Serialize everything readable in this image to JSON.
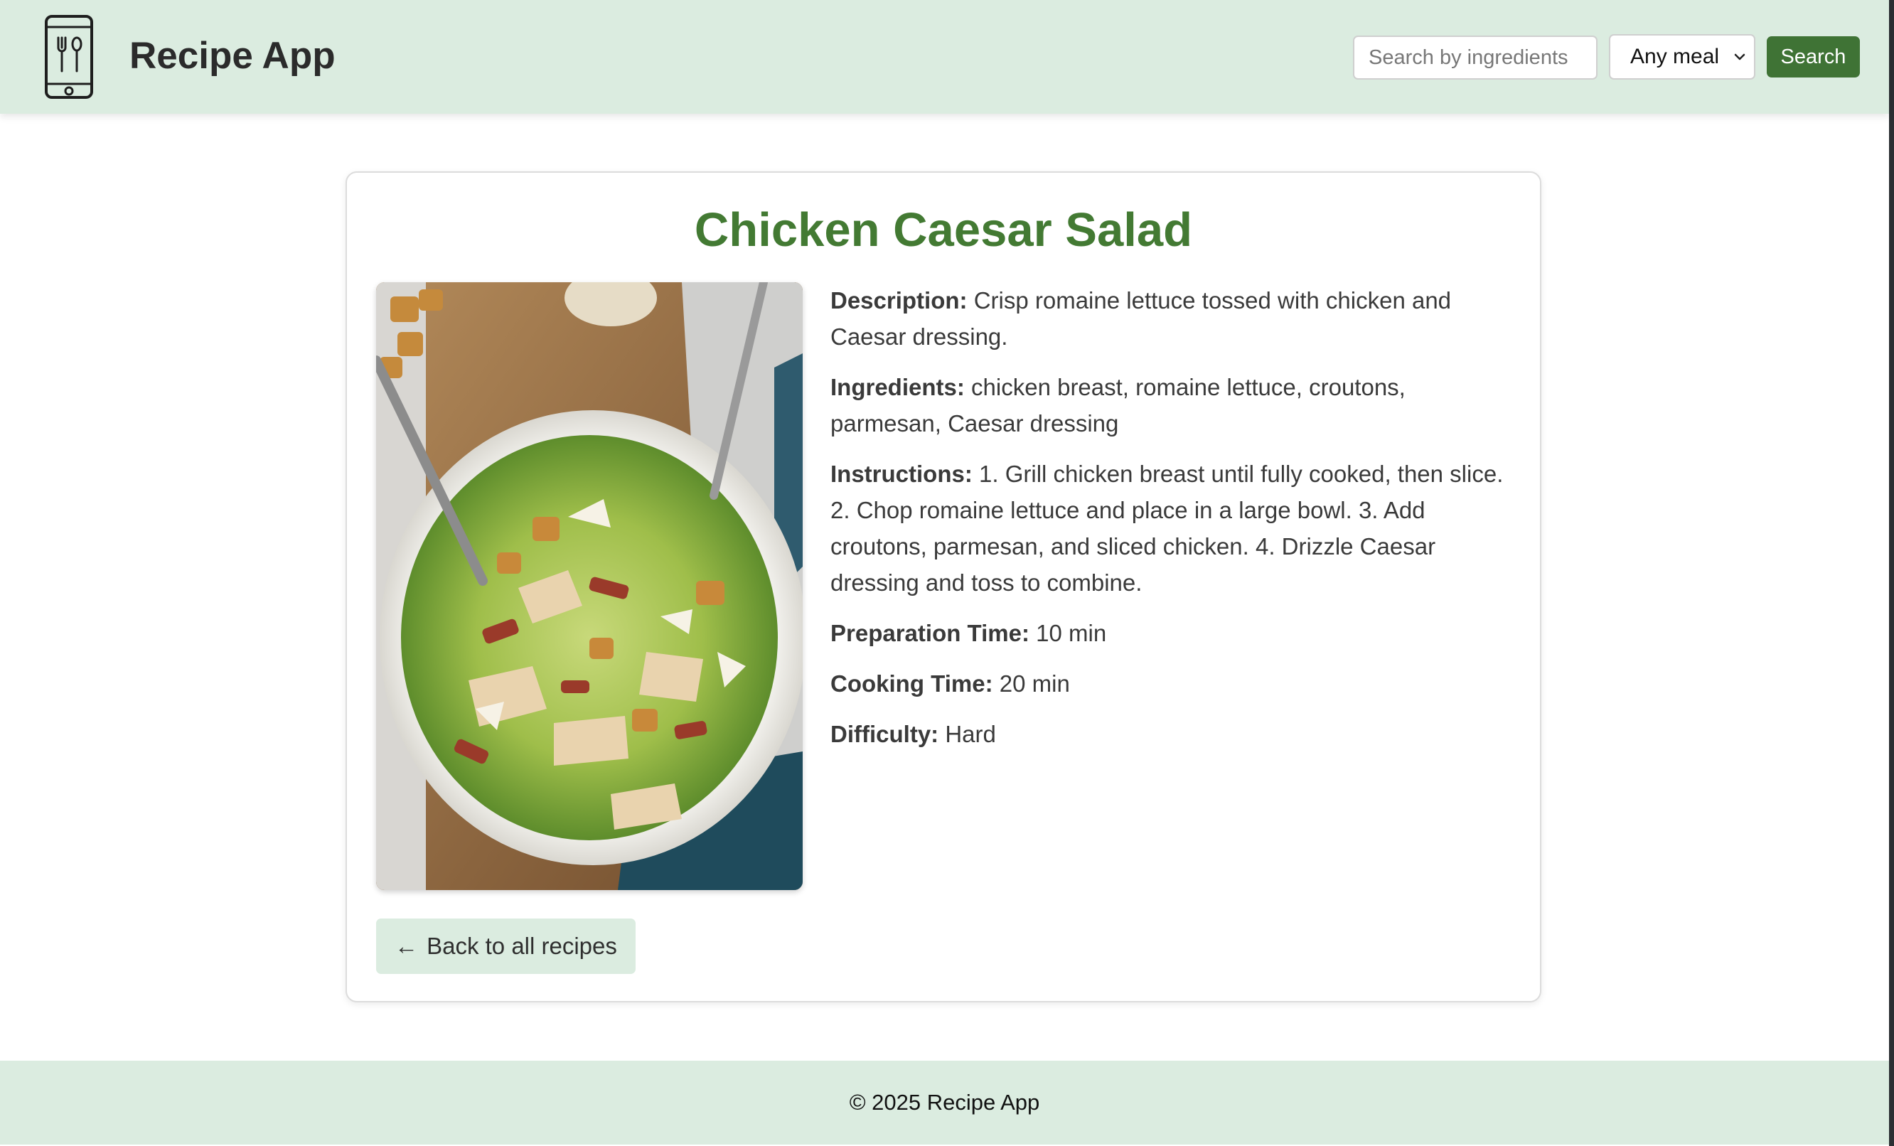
{
  "header": {
    "app_title": "Recipe App",
    "logo_icon": "phone-utensils-icon",
    "search": {
      "placeholder": "Search by ingredients",
      "value": ""
    },
    "meal_filter": {
      "selected": "Any meal"
    },
    "search_button_label": "Search"
  },
  "recipe": {
    "title": "Chicken Caesar Salad",
    "photo": "chicken-caesar-salad-photo",
    "description_label": "Description:",
    "description": "Crisp romaine lettuce tossed with chicken and Caesar dressing.",
    "ingredients_label": "Ingredients:",
    "ingredients": "chicken breast, romaine lettuce, croutons, parmesan, Caesar dressing",
    "instructions_label": "Instructions:",
    "instructions": "1. Grill chicken breast until fully cooked, then slice. 2. Chop romaine lettuce and place in a large bowl. 3. Add croutons, parmesan, and sliced chicken. 4. Drizzle Caesar dressing and toss to combine.",
    "prep_time_label": "Preparation Time:",
    "prep_time": "10 min",
    "cook_time_label": "Cooking Time:",
    "cook_time": "20 min",
    "difficulty_label": "Difficulty:",
    "difficulty": "Hard",
    "back_arrow": "←",
    "back_label": "Back to all recipes"
  },
  "footer": {
    "text": "© 2025 Recipe App"
  },
  "colors": {
    "header_bg": "#dbece0",
    "accent_green": "#3f7335",
    "title_green": "#437a33"
  }
}
